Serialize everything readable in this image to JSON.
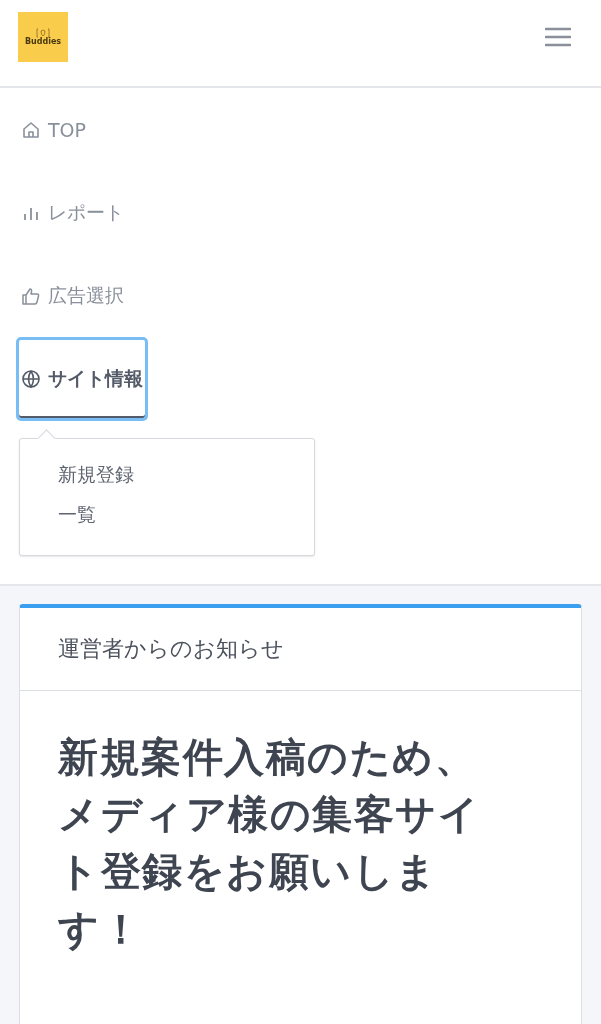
{
  "header": {
    "logo_text": "Buddies"
  },
  "nav": [
    {
      "kind": "home",
      "label": "TOP",
      "selected": false
    },
    {
      "kind": "chart",
      "label": "レポート",
      "selected": false
    },
    {
      "kind": "thumb",
      "label": "広告選択",
      "selected": false
    },
    {
      "kind": "globe",
      "label": "サイト情報",
      "selected": true,
      "expanded": true,
      "children": [
        {
          "label": "新規登録"
        },
        {
          "label": "一覧"
        }
      ]
    }
  ],
  "notice": {
    "title": "運営者からのお知らせ",
    "headline_lines": [
      "新規案件入稿のため、",
      "メディア様の集客サイ",
      "ト登録をお願いしま",
      "す！"
    ]
  }
}
